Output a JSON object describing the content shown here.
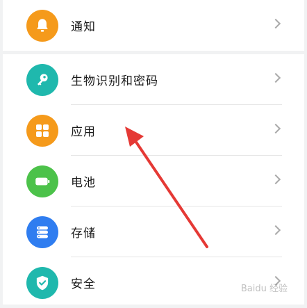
{
  "settings": {
    "items": [
      {
        "label": "通知",
        "icon": "bell-icon",
        "color": "#f59a1b"
      },
      {
        "label": "生物识别和密码",
        "icon": "key-icon",
        "color": "#1fb8ad"
      },
      {
        "label": "应用",
        "icon": "apps-grid-icon",
        "color": "#f59a1b"
      },
      {
        "label": "电池",
        "icon": "battery-icon",
        "color": "#4cc24a"
      },
      {
        "label": "存储",
        "icon": "storage-icon",
        "color": "#2f7df0"
      },
      {
        "label": "安全",
        "icon": "shield-check-icon",
        "color": "#1fb8ad"
      }
    ]
  },
  "annotation": {
    "color": "#e53935"
  },
  "watermark": {
    "text": "Baidu 经验"
  }
}
